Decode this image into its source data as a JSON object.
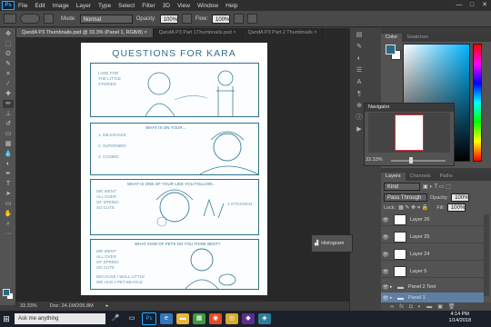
{
  "app": {
    "logo": "Ps"
  },
  "menu": [
    "File",
    "Edit",
    "Image",
    "Layer",
    "Type",
    "Select",
    "Filter",
    "3D",
    "View",
    "Window",
    "Help"
  ],
  "window_controls": [
    "—",
    "□",
    "✕"
  ],
  "options": {
    "mode_label": "Mode:",
    "mode_value": "Normal",
    "opacity_label": "Opacity:",
    "opacity_value": "100%",
    "flow_label": "Flow:",
    "flow_value": "100%"
  },
  "tabs": [
    {
      "label": "QandA P3 Thumbnails.psd @ 33.3% (Panel 1, RGB/8) ×",
      "active": true
    },
    {
      "label": "QandA P3 Part 1Thumbnails.psd ×",
      "active": false
    },
    {
      "label": "QandA P3 Part 2 Thumbnails ×",
      "active": false
    }
  ],
  "document": {
    "title": "QUESTIONS FOR KARA",
    "captions": [
      "WHAT WOULD YOU LIKE...",
      "WHAT IS ON YOUR...",
      "WHAT IS ONE OF YOUR LIKE YOU FOLLOW...",
      "WHAT KIND OF PETS DO YOU THINK BEST?"
    ],
    "notes": [
      "I ARE FOR\nTHE LITTLE\nSTORIES",
      "1. MILKSHAKE\n\n2. SUPERMEN\n\n3. COSMIC",
      "WE WENT\nALL OVER\nOF SPRING\nSO CUTE",
      "BECAUSE I WALL LITTLE\nWE HAD A PET BEAGLE"
    ],
    "dim_label": "1 STICKMAN"
  },
  "status": {
    "zoom": "33.33%",
    "doc": "Doc: 24.1M/205.8M",
    "arrow": "▸"
  },
  "panels": {
    "color_tabs": [
      "Color",
      "Swatches"
    ],
    "navigator_title": "Navigator",
    "navigator_zoom": "33.33%",
    "histogram_label": "Histogram",
    "layers_tabs": [
      "Layers",
      "Channels",
      "Paths"
    ],
    "kind_value": "Kind",
    "blend_value": "Pass Through",
    "opacity_label": "Opacity:",
    "opacity_value": "100%",
    "lock_label": "Lock:",
    "fill_label": "Fill:",
    "fill_value": "100%"
  },
  "layers": [
    {
      "name": "Layer 26",
      "selected": false,
      "group": false
    },
    {
      "name": "Layer 25",
      "selected": false,
      "group": false
    },
    {
      "name": "Layer 24",
      "selected": false,
      "group": false
    },
    {
      "name": "Layer 5",
      "selected": false,
      "group": false
    },
    {
      "name": "Panel 2 Text",
      "selected": false,
      "group": true
    },
    {
      "name": "Panel 1",
      "selected": true,
      "group": true
    }
  ],
  "taskbar": {
    "search_placeholder": "Ask me anything",
    "time": "4:14 PM",
    "date": "1/14/2018"
  },
  "colors": {
    "accent": "#2f7289",
    "selection": "#5d7fa3",
    "foreground": "#2a6a85"
  },
  "icons": [
    "ps-logo-icon",
    "brush-preset-icon",
    "move-tool-icon",
    "marquee-tool-icon",
    "lasso-tool-icon",
    "brush-tool-icon",
    "eye-icon",
    "folder-icon",
    "histogram-icon",
    "windows-start-icon",
    "search-icon"
  ]
}
